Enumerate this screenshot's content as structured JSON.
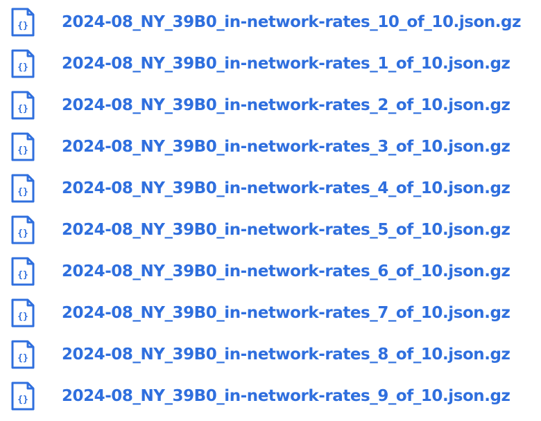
{
  "theme": {
    "link_color": "#2f6fde",
    "icon_color": "#2f6fde"
  },
  "files": [
    {
      "name": "2024-08_NY_39B0_in-network-rates_10_of_10.json.gz",
      "icon": "json-file-icon"
    },
    {
      "name": "2024-08_NY_39B0_in-network-rates_1_of_10.json.gz",
      "icon": "json-file-icon"
    },
    {
      "name": "2024-08_NY_39B0_in-network-rates_2_of_10.json.gz",
      "icon": "json-file-icon"
    },
    {
      "name": "2024-08_NY_39B0_in-network-rates_3_of_10.json.gz",
      "icon": "json-file-icon"
    },
    {
      "name": "2024-08_NY_39B0_in-network-rates_4_of_10.json.gz",
      "icon": "json-file-icon"
    },
    {
      "name": "2024-08_NY_39B0_in-network-rates_5_of_10.json.gz",
      "icon": "json-file-icon"
    },
    {
      "name": "2024-08_NY_39B0_in-network-rates_6_of_10.json.gz",
      "icon": "json-file-icon"
    },
    {
      "name": "2024-08_NY_39B0_in-network-rates_7_of_10.json.gz",
      "icon": "json-file-icon"
    },
    {
      "name": "2024-08_NY_39B0_in-network-rates_8_of_10.json.gz",
      "icon": "json-file-icon"
    },
    {
      "name": "2024-08_NY_39B0_in-network-rates_9_of_10.json.gz",
      "icon": "json-file-icon"
    }
  ]
}
